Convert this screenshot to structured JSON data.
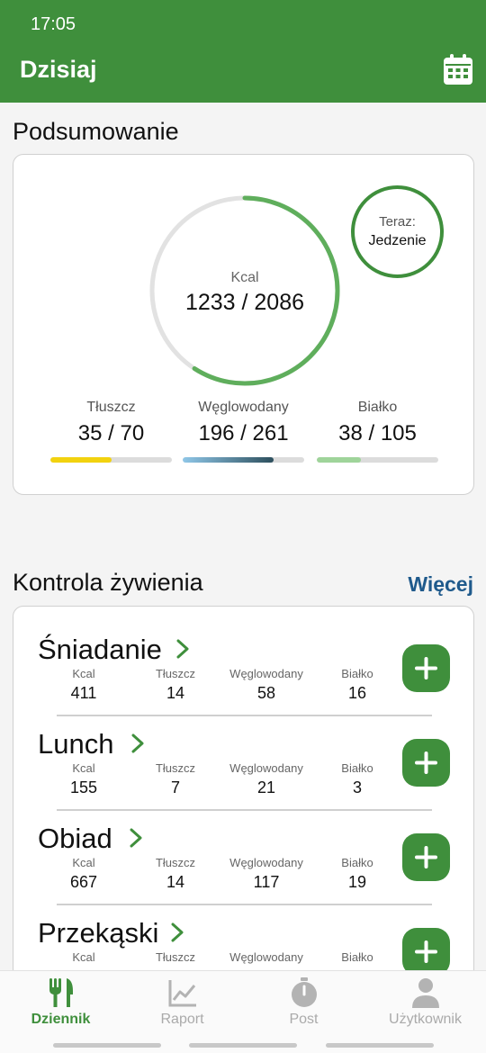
{
  "status": {
    "time": "17:05"
  },
  "header": {
    "title": "Dzisiaj",
    "icon": "calendar-icon"
  },
  "summary": {
    "title": "Podsumowanie",
    "kcal": {
      "label": "Kcal",
      "value": "1233 / 2086",
      "current": 1233,
      "goal": 2086,
      "color": "#5fae5c"
    },
    "now": {
      "label": "Teraz:",
      "value": "Jedzenie"
    },
    "macros": [
      {
        "label": "Tłuszcz",
        "value": "35 / 70",
        "fraction": 0.5,
        "color": "#f2d20f"
      },
      {
        "label": "Węglowodany",
        "value": "196 / 261",
        "fraction": 0.75,
        "color": "#2d4f5d"
      },
      {
        "label": "Białko",
        "value": "38 / 105",
        "fraction": 0.36,
        "color": "#9fd49a"
      }
    ]
  },
  "control": {
    "title": "Kontrola żywienia",
    "more": "Więcej",
    "nutrient_labels": [
      "Kcal",
      "Tłuszcz",
      "Węglowodany",
      "Białko"
    ],
    "meals": [
      {
        "name": "Śniadanie",
        "values": [
          "411",
          "14",
          "58",
          "16"
        ]
      },
      {
        "name": "Lunch",
        "values": [
          "155",
          "7",
          "21",
          "3"
        ]
      },
      {
        "name": "Obiad",
        "values": [
          "667",
          "14",
          "117",
          "19"
        ]
      },
      {
        "name": "Przekąski",
        "values": [
          "",
          "",
          "",
          ""
        ]
      }
    ]
  },
  "nav": [
    {
      "label": "Dziennik",
      "icon": "fork-knife-icon",
      "active": true
    },
    {
      "label": "Raport",
      "icon": "chart-line-icon",
      "active": false
    },
    {
      "label": "Post",
      "icon": "stopwatch-icon",
      "active": false
    },
    {
      "label": "Użytkownik",
      "icon": "user-icon",
      "active": false
    }
  ],
  "colors": {
    "brand": "#3f8f3c",
    "link": "#1f5a8c"
  }
}
